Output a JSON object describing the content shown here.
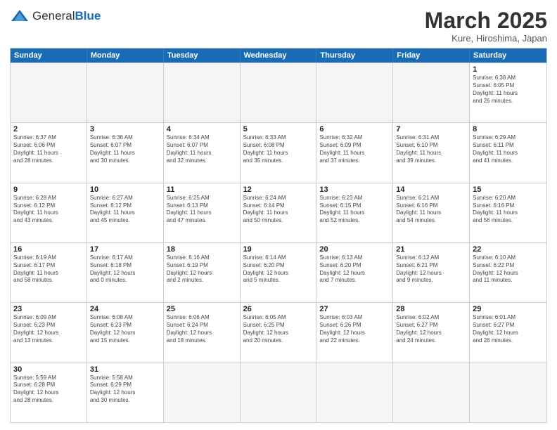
{
  "header": {
    "logo_general": "General",
    "logo_blue": "Blue",
    "month_title": "March 2025",
    "subtitle": "Kure, Hiroshima, Japan"
  },
  "days_of_week": [
    "Sunday",
    "Monday",
    "Tuesday",
    "Wednesday",
    "Thursday",
    "Friday",
    "Saturday"
  ],
  "weeks": [
    [
      {
        "day": "",
        "info": ""
      },
      {
        "day": "",
        "info": ""
      },
      {
        "day": "",
        "info": ""
      },
      {
        "day": "",
        "info": ""
      },
      {
        "day": "",
        "info": ""
      },
      {
        "day": "",
        "info": ""
      },
      {
        "day": "1",
        "info": "Sunrise: 6:38 AM\nSunset: 6:05 PM\nDaylight: 11 hours\nand 26 minutes."
      }
    ],
    [
      {
        "day": "2",
        "info": "Sunrise: 6:37 AM\nSunset: 6:06 PM\nDaylight: 11 hours\nand 28 minutes."
      },
      {
        "day": "3",
        "info": "Sunrise: 6:36 AM\nSunset: 6:07 PM\nDaylight: 11 hours\nand 30 minutes."
      },
      {
        "day": "4",
        "info": "Sunrise: 6:34 AM\nSunset: 6:07 PM\nDaylight: 11 hours\nand 32 minutes."
      },
      {
        "day": "5",
        "info": "Sunrise: 6:33 AM\nSunset: 6:08 PM\nDaylight: 11 hours\nand 35 minutes."
      },
      {
        "day": "6",
        "info": "Sunrise: 6:32 AM\nSunset: 6:09 PM\nDaylight: 11 hours\nand 37 minutes."
      },
      {
        "day": "7",
        "info": "Sunrise: 6:31 AM\nSunset: 6:10 PM\nDaylight: 11 hours\nand 39 minutes."
      },
      {
        "day": "8",
        "info": "Sunrise: 6:29 AM\nSunset: 6:11 PM\nDaylight: 11 hours\nand 41 minutes."
      }
    ],
    [
      {
        "day": "9",
        "info": "Sunrise: 6:28 AM\nSunset: 6:12 PM\nDaylight: 11 hours\nand 43 minutes."
      },
      {
        "day": "10",
        "info": "Sunrise: 6:27 AM\nSunset: 6:12 PM\nDaylight: 11 hours\nand 45 minutes."
      },
      {
        "day": "11",
        "info": "Sunrise: 6:25 AM\nSunset: 6:13 PM\nDaylight: 11 hours\nand 47 minutes."
      },
      {
        "day": "12",
        "info": "Sunrise: 6:24 AM\nSunset: 6:14 PM\nDaylight: 11 hours\nand 50 minutes."
      },
      {
        "day": "13",
        "info": "Sunrise: 6:23 AM\nSunset: 6:15 PM\nDaylight: 11 hours\nand 52 minutes."
      },
      {
        "day": "14",
        "info": "Sunrise: 6:21 AM\nSunset: 6:16 PM\nDaylight: 11 hours\nand 54 minutes."
      },
      {
        "day": "15",
        "info": "Sunrise: 6:20 AM\nSunset: 6:16 PM\nDaylight: 11 hours\nand 56 minutes."
      }
    ],
    [
      {
        "day": "16",
        "info": "Sunrise: 6:19 AM\nSunset: 6:17 PM\nDaylight: 11 hours\nand 58 minutes."
      },
      {
        "day": "17",
        "info": "Sunrise: 6:17 AM\nSunset: 6:18 PM\nDaylight: 12 hours\nand 0 minutes."
      },
      {
        "day": "18",
        "info": "Sunrise: 6:16 AM\nSunset: 6:19 PM\nDaylight: 12 hours\nand 2 minutes."
      },
      {
        "day": "19",
        "info": "Sunrise: 6:14 AM\nSunset: 6:20 PM\nDaylight: 12 hours\nand 5 minutes."
      },
      {
        "day": "20",
        "info": "Sunrise: 6:13 AM\nSunset: 6:20 PM\nDaylight: 12 hours\nand 7 minutes."
      },
      {
        "day": "21",
        "info": "Sunrise: 6:12 AM\nSunset: 6:21 PM\nDaylight: 12 hours\nand 9 minutes."
      },
      {
        "day": "22",
        "info": "Sunrise: 6:10 AM\nSunset: 6:22 PM\nDaylight: 12 hours\nand 11 minutes."
      }
    ],
    [
      {
        "day": "23",
        "info": "Sunrise: 6:09 AM\nSunset: 6:23 PM\nDaylight: 12 hours\nand 13 minutes."
      },
      {
        "day": "24",
        "info": "Sunrise: 6:08 AM\nSunset: 6:23 PM\nDaylight: 12 hours\nand 15 minutes."
      },
      {
        "day": "25",
        "info": "Sunrise: 6:06 AM\nSunset: 6:24 PM\nDaylight: 12 hours\nand 18 minutes."
      },
      {
        "day": "26",
        "info": "Sunrise: 6:05 AM\nSunset: 6:25 PM\nDaylight: 12 hours\nand 20 minutes."
      },
      {
        "day": "27",
        "info": "Sunrise: 6:03 AM\nSunset: 6:26 PM\nDaylight: 12 hours\nand 22 minutes."
      },
      {
        "day": "28",
        "info": "Sunrise: 6:02 AM\nSunset: 6:27 PM\nDaylight: 12 hours\nand 24 minutes."
      },
      {
        "day": "29",
        "info": "Sunrise: 6:01 AM\nSunset: 6:27 PM\nDaylight: 12 hours\nand 26 minutes."
      }
    ],
    [
      {
        "day": "30",
        "info": "Sunrise: 5:59 AM\nSunset: 6:28 PM\nDaylight: 12 hours\nand 28 minutes."
      },
      {
        "day": "31",
        "info": "Sunrise: 5:58 AM\nSunset: 6:29 PM\nDaylight: 12 hours\nand 30 minutes."
      },
      {
        "day": "",
        "info": ""
      },
      {
        "day": "",
        "info": ""
      },
      {
        "day": "",
        "info": ""
      },
      {
        "day": "",
        "info": ""
      },
      {
        "day": "",
        "info": ""
      }
    ]
  ]
}
